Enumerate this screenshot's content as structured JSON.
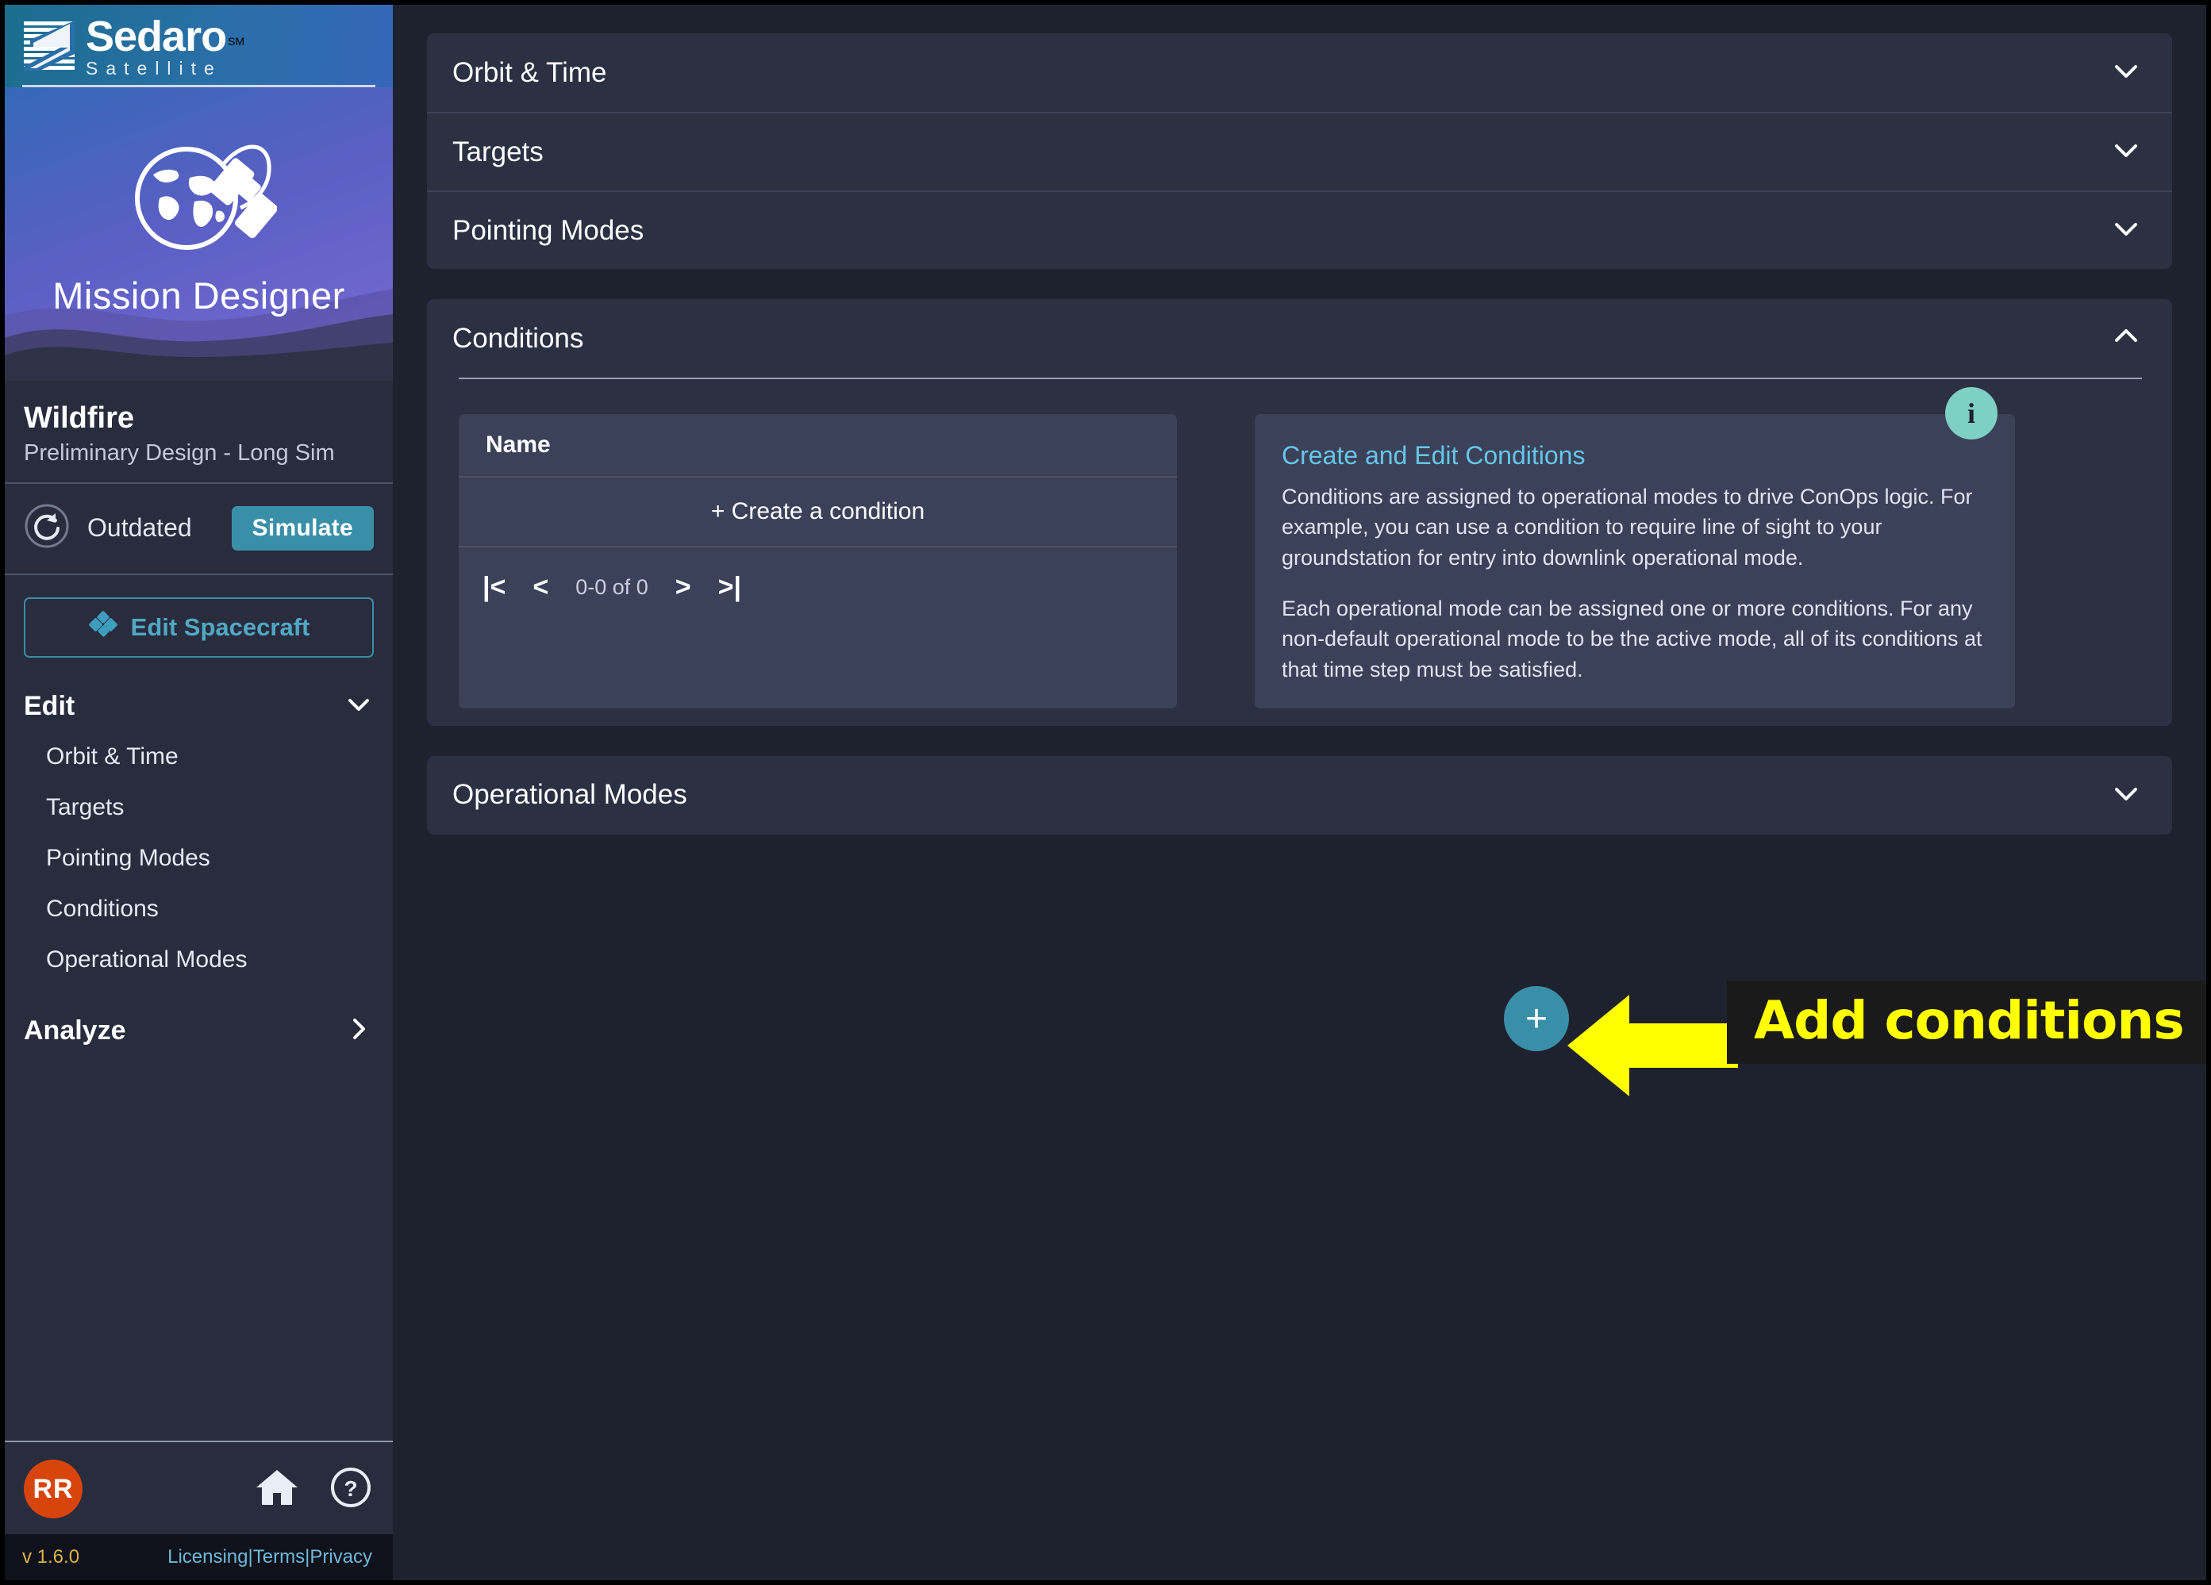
{
  "sidebar": {
    "logo": {
      "brand": "Sedaro",
      "trademark": "SM",
      "product": "Satellite",
      "mark_icon": "sedaro-logo-mark"
    },
    "banner": {
      "title": "Mission Designer",
      "icon": "globe-satellite-icon"
    },
    "project": {
      "name": "Wildfire",
      "subtitle": "Preliminary Design - Long Sim"
    },
    "status": {
      "icon": "refresh-icon",
      "label": "Outdated",
      "button": "Simulate"
    },
    "edit_spacecraft": {
      "label": "Edit Spacecraft",
      "icon": "satellite-icon"
    },
    "nav": {
      "edit": {
        "label": "Edit",
        "chevron": "chevron-down-icon"
      },
      "edit_items": [
        {
          "label": "Orbit & Time"
        },
        {
          "label": "Targets"
        },
        {
          "label": "Pointing Modes"
        },
        {
          "label": "Conditions"
        },
        {
          "label": "Operational Modes"
        }
      ],
      "analyze": {
        "label": "Analyze",
        "chevron": "chevron-right-icon"
      }
    },
    "bottom": {
      "avatar": "RR",
      "home_icon": "home-icon",
      "help_icon": "help-circle-icon"
    },
    "footer": {
      "version": "v 1.6.0",
      "licensing": "Licensing",
      "sep1": "|",
      "terms": "Terms",
      "sep2": "|",
      "privacy": "Privacy"
    }
  },
  "main": {
    "accordions_top": [
      {
        "title": "Orbit & Time",
        "chevron": "chevron-down-icon"
      },
      {
        "title": "Targets",
        "chevron": "chevron-down-icon"
      },
      {
        "title": "Pointing Modes",
        "chevron": "chevron-down-icon"
      }
    ],
    "conditions": {
      "title": "Conditions",
      "chevron": "chevron-up-icon",
      "table": {
        "columns": [
          "Name"
        ],
        "create_row": "+ Create a condition",
        "pager": {
          "first": "|<",
          "prev": "<",
          "count": "0-0 of 0",
          "next": ">",
          "last": ">|"
        }
      },
      "fab": {
        "label": "+",
        "name": "add-condition-fab"
      },
      "info": {
        "badge": "i",
        "title": "Create and Edit Conditions",
        "paragraph1": "Conditions are assigned to operational modes to drive ConOps logic. For example, you can use a condition to require line of sight to your groundstation for entry into downlink operational mode.",
        "paragraph2": "Each operational mode can be assigned one or more conditions. For any non-default operational mode to be the active mode, all of its conditions at that time step must be satisfied."
      }
    },
    "operational_modes": {
      "title": "Operational Modes",
      "chevron": "chevron-down-icon"
    }
  },
  "annotation": {
    "text": "Add conditions",
    "arrow_icon": "left-arrow-annotation",
    "color": "#ffff00",
    "background": "#1a1a1a"
  },
  "colors": {
    "accent_teal": "#3a8fa8",
    "link_blue": "#66c6e8",
    "info_badge": "#7fd0c4",
    "avatar_orange": "#d8450c",
    "panel_bg": "#2b3042",
    "app_bg": "#1e222e",
    "sidebar_bg": "#282c3d",
    "table_bg": "#3b4159"
  }
}
